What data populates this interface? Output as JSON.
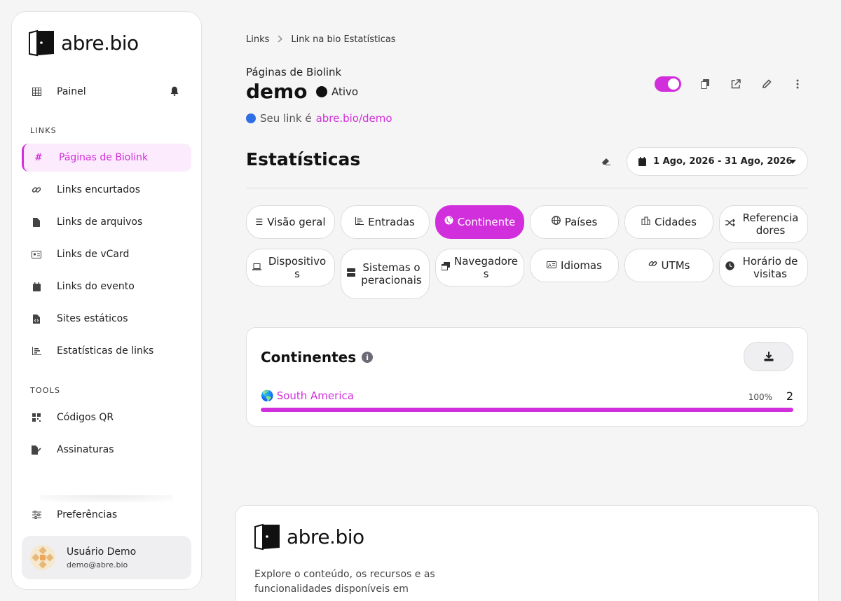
{
  "brand": {
    "name": "abre.bio",
    "accent": "#d22fdc"
  },
  "sidebar": {
    "top_item": "Painel",
    "links_section": "LINKS",
    "items": [
      {
        "label": "Páginas de Biolink",
        "icon": "hash-icon",
        "active": true
      },
      {
        "label": "Links encurtados",
        "icon": "link-icon"
      },
      {
        "label": "Links de arquivos",
        "icon": "file-icon"
      },
      {
        "label": "Links de vCard",
        "icon": "id-card-icon"
      },
      {
        "label": "Links do evento",
        "icon": "calendar-icon"
      },
      {
        "label": "Sites estáticos",
        "icon": "file-code-icon"
      },
      {
        "label": "Estatísticas de links",
        "icon": "chart-bar-icon"
      }
    ],
    "tools_section": "TOOLS",
    "tools": [
      {
        "label": "Códigos QR",
        "icon": "qrcode-icon"
      },
      {
        "label": "Assinaturas",
        "icon": "signature-icon"
      }
    ],
    "preferences": "Preferências",
    "user": {
      "name": "Usuário Demo",
      "email": "demo@abre.bio"
    }
  },
  "breadcrumb": {
    "first": "Links",
    "second": "Link na bio Estatísticas"
  },
  "header": {
    "kicker": "Páginas de Biolink",
    "title": "demo",
    "status": "Ativo",
    "link_prefix": "Seu link é",
    "link_url": "abre.bio/demo"
  },
  "stats": {
    "title": "Estatísticas",
    "date_range": "1 Ago, 2026 - 31 Ago, 2026"
  },
  "tabs": [
    {
      "label": "Visão geral",
      "icon": "list-icon"
    },
    {
      "label": "Entradas",
      "icon": "chart-bar-icon"
    },
    {
      "label": "Continente",
      "icon": "globe-europe-icon",
      "active": true
    },
    {
      "label": "Países",
      "icon": "globe-icon"
    },
    {
      "label": "Cidades",
      "icon": "city-icon"
    },
    {
      "label": "Referenciadores",
      "icon": "random-icon"
    },
    {
      "label": "Dispositivos",
      "icon": "laptop-icon"
    },
    {
      "label": "Sistemas operacionais",
      "icon": "server-icon"
    },
    {
      "label": "Navegadores",
      "icon": "window-restore-icon"
    },
    {
      "label": "Idiomas",
      "icon": "language-icon"
    },
    {
      "label": "UTMs",
      "icon": "link-icon"
    },
    {
      "label": "Horário de visitas",
      "icon": "clock-icon"
    }
  ],
  "continents": {
    "title": "Continentes",
    "rows": [
      {
        "emoji": "🌎",
        "name": "South America",
        "percent": "100%",
        "count": "2",
        "fraction": 1.0
      }
    ]
  },
  "footer": {
    "brand": "abre.bio",
    "text": "Explore o conteúdo, os recursos e as funcionalidades disponíveis em"
  }
}
